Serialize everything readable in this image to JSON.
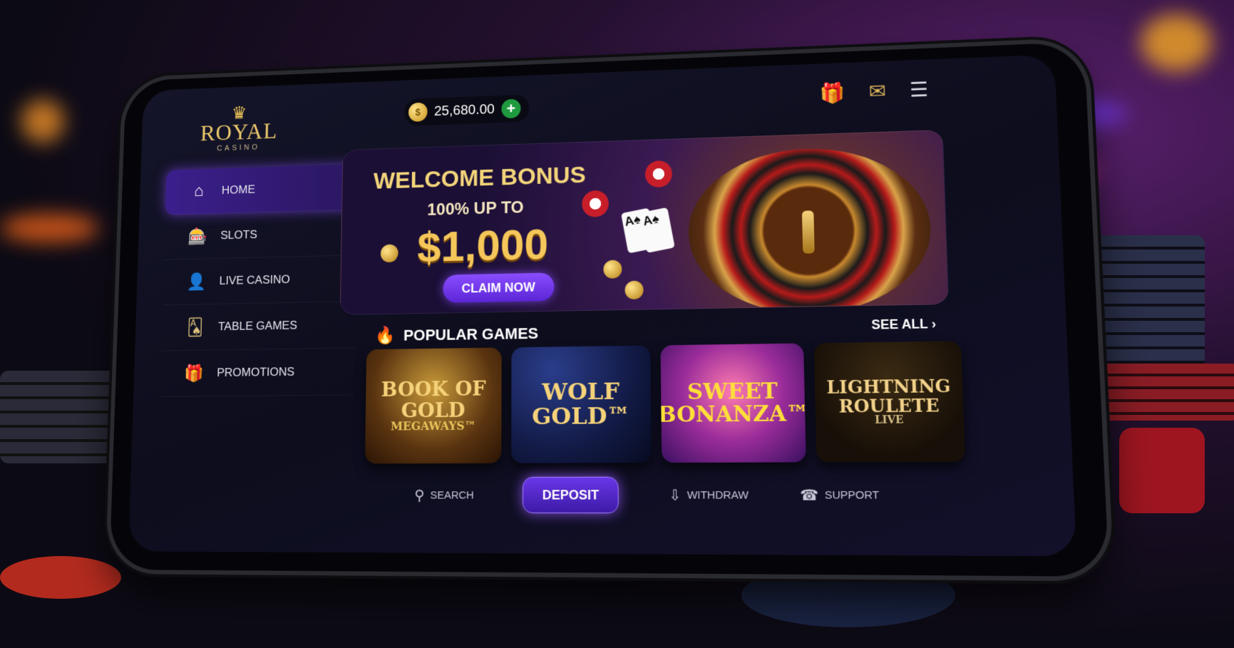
{
  "brand": {
    "name": "ROYAL",
    "sub": "CASINO",
    "crown_icon": "crown-icon"
  },
  "header": {
    "balance": "25,680.00",
    "add_label": "+",
    "icons": [
      "gift-icon",
      "mail-icon",
      "menu-icon"
    ]
  },
  "sidebar": {
    "items": [
      {
        "label": "HOME",
        "icon": "home-icon",
        "active": true
      },
      {
        "label": "SLOTS",
        "icon": "slot-machine-icon",
        "active": false
      },
      {
        "label": "LIVE CASINO",
        "icon": "dealer-icon",
        "active": false
      },
      {
        "label": "TABLE GAMES",
        "icon": "cards-icon",
        "active": false
      },
      {
        "label": "PROMOTIONS",
        "icon": "gift-icon",
        "active": false
      }
    ]
  },
  "banner": {
    "title": "WELCOME BONUS",
    "subtitle": "100% UP TO",
    "amount": "$1,000",
    "cta": "CLAIM NOW"
  },
  "popular": {
    "title": "POPULAR GAMES",
    "see_all": "SEE ALL ›"
  },
  "games": [
    {
      "line1": "BOOK OF",
      "line2": "GOLD",
      "sub": "MEGAWAYS™"
    },
    {
      "line1": "WOLF",
      "line2": "GOLD™",
      "sub": ""
    },
    {
      "line1": "SWEET",
      "line2": "BONANZA™",
      "sub": ""
    },
    {
      "line1": "LIGHTNING",
      "line2": "ROULETE",
      "sub": "LIVE"
    }
  ],
  "bottom_bar": {
    "search": "SEARCH",
    "deposit": "DEPOSIT",
    "withdraw": "WITHDRAW",
    "support": "SUPPORT"
  },
  "colors": {
    "accent": "#6a36e8",
    "gold": "#f2d47a",
    "background": "#0d0d1d"
  }
}
